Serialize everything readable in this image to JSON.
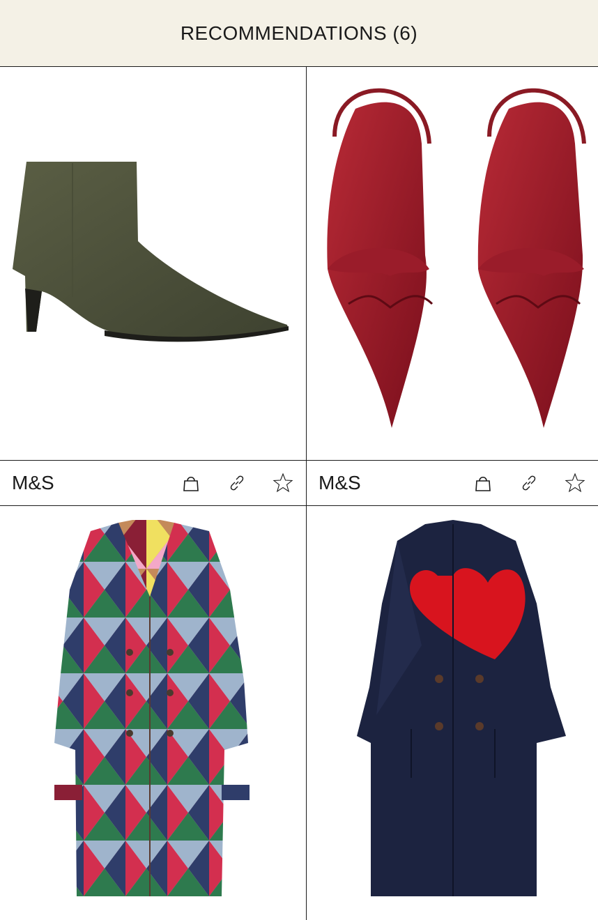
{
  "header": {
    "title": "RECOMMENDATIONS (6)"
  },
  "products": [
    {
      "brand": "M&S",
      "image": "olive-suede-ankle-boot",
      "icons": [
        "shopping-bag-icon",
        "link-icon",
        "star-icon"
      ]
    },
    {
      "brand": "M&S",
      "image": "red-patent-slingback-flats",
      "icons": [
        "shopping-bag-icon",
        "link-icon",
        "star-icon"
      ]
    },
    {
      "brand": "",
      "image": "multicolour-harlequin-trench-coat",
      "icons": []
    },
    {
      "brand": "",
      "image": "navy-coat-with-red-heart-lapel",
      "icons": []
    }
  ],
  "colors": {
    "header_bg": "#f4f1e6",
    "border": "#1a1a1a",
    "text": "#1a1a1a"
  }
}
